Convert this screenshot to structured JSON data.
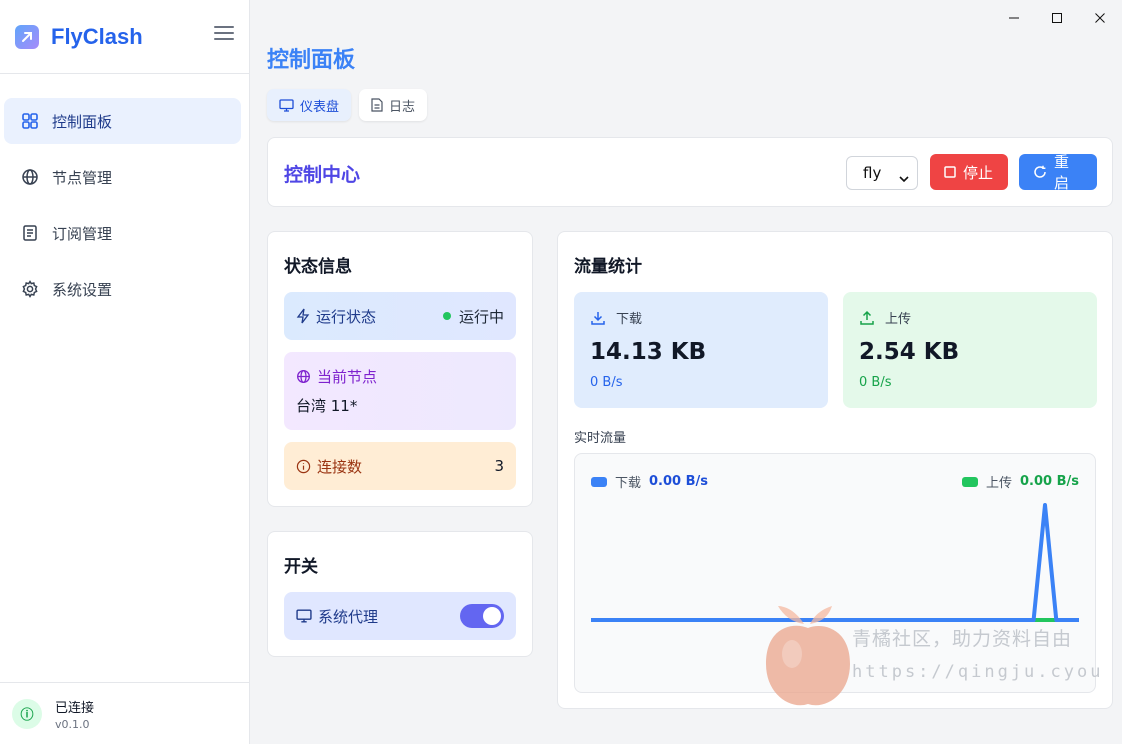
{
  "app": {
    "title": "FlyClash",
    "version": "v0.1.0",
    "connection_status": "已连接"
  },
  "sidebar": {
    "items": [
      {
        "label": "控制面板",
        "icon": "dashboard-grid-icon",
        "active": true
      },
      {
        "label": "节点管理",
        "icon": "globe-icon",
        "active": false
      },
      {
        "label": "订阅管理",
        "icon": "document-icon",
        "active": false
      },
      {
        "label": "系统设置",
        "icon": "gear-icon",
        "active": false
      }
    ]
  },
  "page": {
    "title": "控制面板",
    "tabs": [
      {
        "label": "仪表盘",
        "icon": "monitor-icon",
        "active": true
      },
      {
        "label": "日志",
        "icon": "file-icon",
        "active": false
      }
    ]
  },
  "control_center": {
    "title": "控制中心",
    "profile_selected": "fly",
    "stop_label": "停止",
    "restart_label": "重启"
  },
  "status_info": {
    "title": "状态信息",
    "run_state_label": "运行状态",
    "run_state_value": "运行中",
    "current_node_label": "当前节点",
    "current_node_value": "台湾 11*",
    "connections_label": "连接数",
    "connections_value": "3"
  },
  "switches": {
    "title": "开关",
    "system_proxy_label": "系统代理",
    "system_proxy_on": true
  },
  "traffic": {
    "title": "流量统计",
    "download_label": "下载",
    "download_total": "14.13 KB",
    "download_rate": "0 B/s",
    "upload_label": "上传",
    "upload_total": "2.54 KB",
    "upload_rate": "0 B/s",
    "realtime_label": "实时流量",
    "legend_download_label": "下载",
    "legend_download_value": "0.00 B/s",
    "legend_upload_label": "上传",
    "legend_upload_value": "0.00 B/s"
  },
  "chart_data": {
    "type": "line",
    "series": [
      {
        "name": "下载",
        "color": "#3b82f6",
        "values": [
          0,
          0,
          0,
          0,
          0,
          0,
          0,
          0,
          0,
          0,
          0,
          0,
          0,
          0,
          0,
          0,
          0,
          0,
          0,
          0,
          0,
          0,
          0,
          0,
          0,
          0,
          0,
          0,
          0,
          0,
          0,
          0,
          0,
          0,
          0,
          0,
          0,
          0,
          0,
          0,
          1,
          0,
          0,
          0
        ]
      },
      {
        "name": "上传",
        "color": "#22c55e",
        "values": [
          0,
          0,
          0,
          0,
          0,
          0,
          0,
          0,
          0,
          0,
          0,
          0,
          0,
          0,
          0,
          0,
          0,
          0,
          0,
          0,
          0,
          0,
          0,
          0,
          0,
          0,
          0,
          0,
          0,
          0,
          0,
          0,
          0,
          0,
          0,
          0,
          0,
          0,
          0,
          0,
          0,
          0,
          0,
          0
        ]
      }
    ]
  },
  "watermark": {
    "line1": "青橘社区，助力资料自由",
    "line2": "https://qingju.cyou"
  },
  "colors": {
    "accent": "#3b82f6",
    "stop": "#ef4444",
    "success": "#22c55e"
  }
}
